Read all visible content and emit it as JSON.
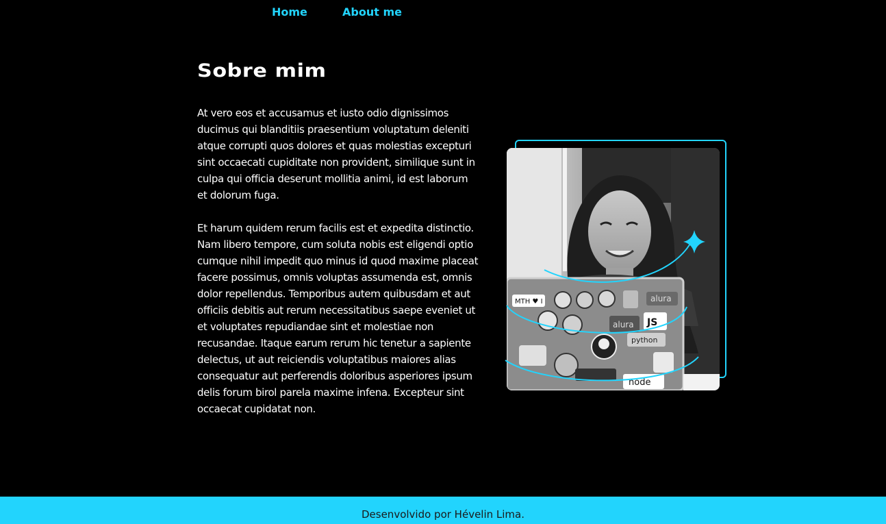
{
  "nav": {
    "home_label": "Home",
    "about_label": "About me"
  },
  "main": {
    "title": "Sobre mim",
    "paragraphs": [
      "At vero eos et accusamus et iusto odio dignissimos ducimus qui blanditiis praesentium voluptatum deleniti atque corrupti quos dolores et quas molestias excepturi sint occaecati cupiditate non provident, similique sunt in culpa qui officia deserunt mollitia animi, id est laborum et dolorum fuga.",
      "Et harum quidem rerum facilis est et expedita distinctio. Nam libero tempore, cum soluta nobis est eligendi optio cumque nihil impedit quo minus id quod maxime placeat facere possimus, omnis voluptas assumenda est, omnis dolor repellendus. Temporibus autem quibusdam et aut officiis debitis aut rerum necessitatibus saepe eveniet ut et voluptates repudiandae sint et molestiae non recusandae. Itaque earum rerum hic tenetur a sapiente delectus, ut aut reiciendis voluptatibus maiores alias consequatur aut perferendis doloribus asperiores ipsum delis forum birol parela maxime infena. Excepteur sint occaecat cupidatat non."
    ],
    "laptop_stickers": [
      "MTH ♥ I",
      "alura",
      "JS",
      "alura",
      "python",
      "node"
    ]
  },
  "footer": {
    "credit": "Desenvolvido por Hévelin Lima."
  },
  "colors": {
    "accent": "#22d4fd",
    "background": "#000000",
    "text": "#ffffff",
    "footer_text": "#1a1a1a"
  }
}
